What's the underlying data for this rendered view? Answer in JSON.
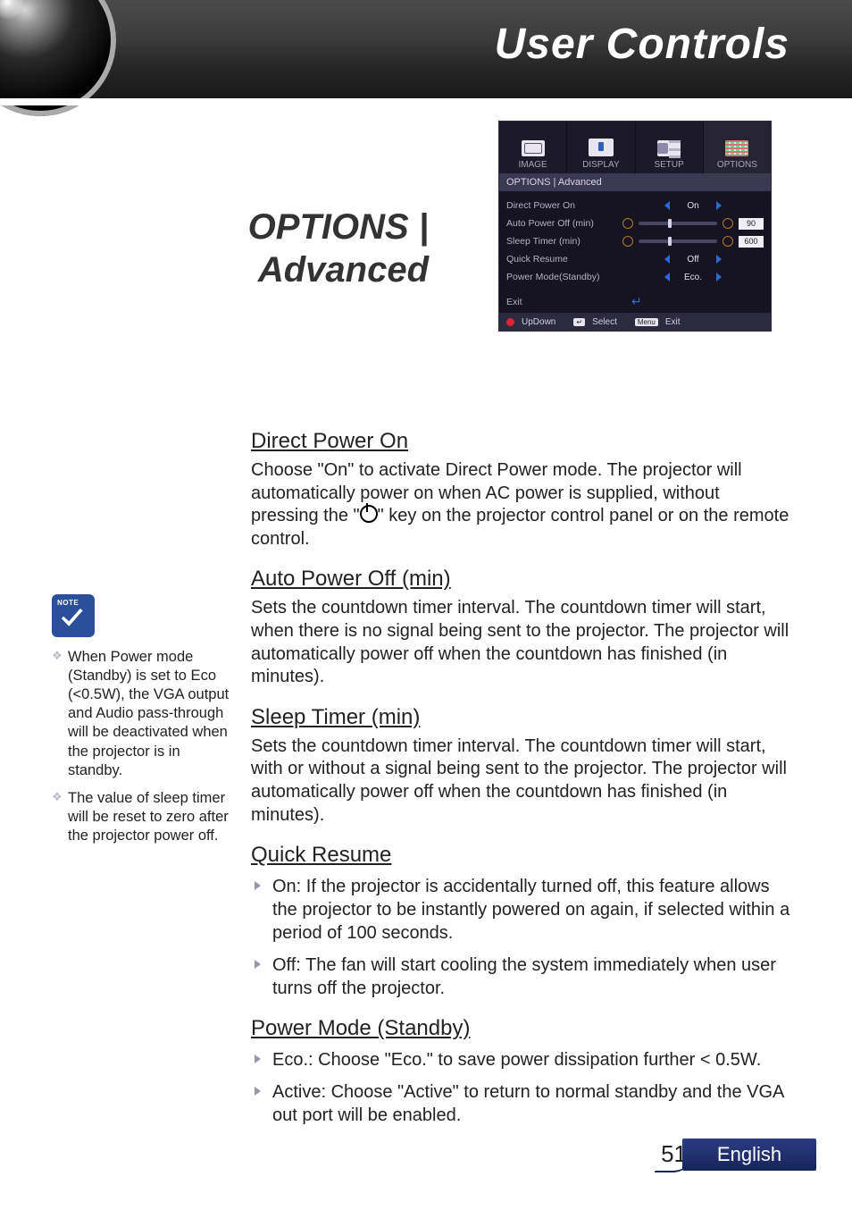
{
  "header": {
    "title": "User Controls"
  },
  "section_title_line1": "OPTIONS |",
  "section_title_line2": "Advanced",
  "osd": {
    "tabs": [
      {
        "label": "IMAGE"
      },
      {
        "label": "DISPLAY"
      },
      {
        "label": "SETUP"
      },
      {
        "label": "OPTIONS"
      }
    ],
    "breadcrumb": "OPTIONS  |  Advanced",
    "rows": {
      "direct_power_on": {
        "label": "Direct Power On",
        "value": "On"
      },
      "auto_power_off": {
        "label": "Auto Power Off (min)",
        "value": "90"
      },
      "sleep_timer": {
        "label": "Sleep Timer (min)",
        "value": "600"
      },
      "quick_resume": {
        "label": "Quick Resume",
        "value": "Off"
      },
      "power_mode": {
        "label": "Power Mode(Standby)",
        "value": "Eco."
      }
    },
    "exit_label": "Exit",
    "footer": {
      "updown": "UpDown",
      "select": "Select",
      "menu_key": "Menu",
      "exit": "Exit"
    }
  },
  "body": {
    "direct_power_on": {
      "heading": "Direct Power On",
      "text_a": "Choose \"On\" to activate Direct Power mode. The projector will automatically power on when AC power is supplied, without pressing the \"",
      "text_b": "\" key on the projector control panel or on the remote control."
    },
    "auto_power_off": {
      "heading": "Auto Power Off (min)",
      "text": "Sets the countdown timer interval. The countdown timer will start, when there is no signal being sent to the projector. The projector will automatically power off when the countdown has finished (in minutes)."
    },
    "sleep_timer": {
      "heading": "Sleep Timer (min)",
      "text": "Sets the countdown timer interval. The countdown timer will start, with or without a signal being sent to the projector. The projector will automatically power off when the countdown has finished (in minutes)."
    },
    "quick_resume": {
      "heading": "Quick Resume",
      "bullets": [
        "On: If the projector is accidentally turned off, this feature allows the projector to be instantly powered on again, if selected within a period of 100 seconds.",
        "Off: The fan will start cooling the system immediately when user turns off the projector."
      ]
    },
    "power_mode": {
      "heading": "Power Mode (Standby)",
      "bullets": [
        "Eco.: Choose \"Eco.\" to save power dissipation further < 0.5W.",
        "Active: Choose \"Active\" to return to normal standby and the VGA out port will be enabled."
      ]
    }
  },
  "sidenotes": [
    "When Power mode (Standby) is set to Eco (<0.5W), the VGA output and Audio pass-through will be deactivated when the projector is in standby.",
    "The value of sleep timer will be reset to zero after the  projector power off."
  ],
  "footer": {
    "page": "51",
    "language": "English"
  }
}
